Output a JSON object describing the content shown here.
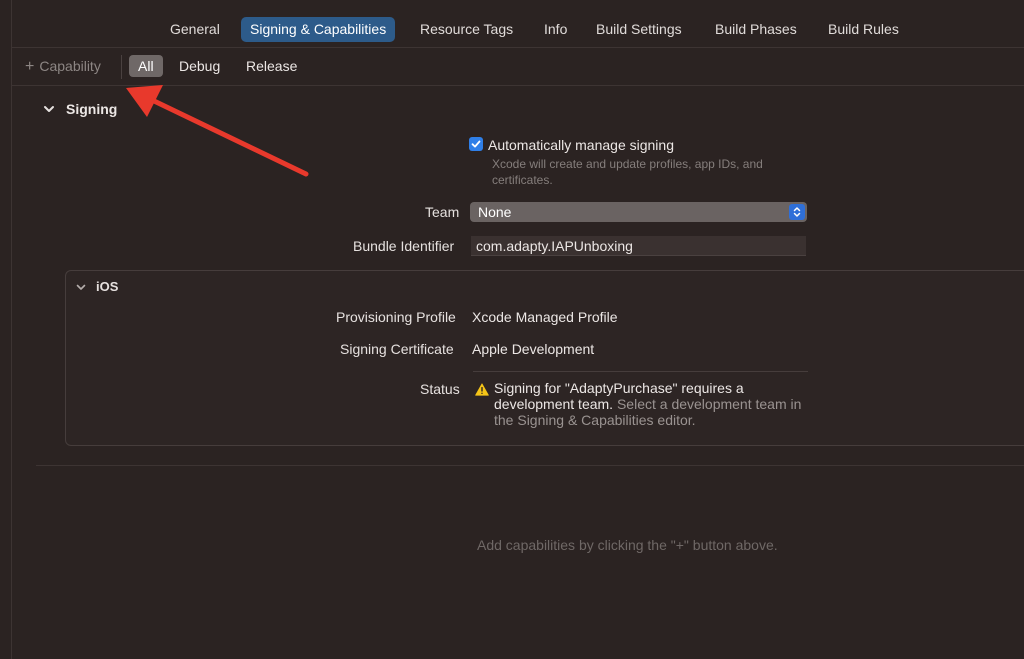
{
  "tabs": [
    {
      "label": "General"
    },
    {
      "label": "Signing & Capabilities"
    },
    {
      "label": "Resource Tags"
    },
    {
      "label": "Info"
    },
    {
      "label": "Build Settings"
    },
    {
      "label": "Build Phases"
    },
    {
      "label": "Build Rules"
    }
  ],
  "selected_tab": "Signing & Capabilities",
  "filterbar": {
    "add_capability": "Capability",
    "filters": [
      {
        "label": "All"
      },
      {
        "label": "Debug"
      },
      {
        "label": "Release"
      }
    ],
    "active_filter": "All"
  },
  "signing": {
    "title": "Signing",
    "auto_manage_label": "Automatically manage signing",
    "auto_manage_checked": true,
    "auto_manage_desc": "Xcode will create and update profiles, app IDs, and certificates.",
    "team_label": "Team",
    "team_value": "None",
    "bundle_label": "Bundle Identifier",
    "bundle_value": "com.adapty.IAPUnboxing"
  },
  "ios": {
    "title": "iOS",
    "provisioning_label": "Provisioning Profile",
    "provisioning_value": "Xcode Managed Profile",
    "certificate_label": "Signing Certificate",
    "certificate_value": "Apple Development",
    "status_label": "Status",
    "status_main": "Signing for \"AdaptyPurchase\" requires a development team.",
    "status_detail": "Select a development team in the Signing & Capabilities editor."
  },
  "hint": "Add capabilities by clicking the \"+\" button above.",
  "colors": {
    "background": "#2b2322",
    "accent": "#2d5b8a",
    "checkbox": "#2f7fe8",
    "warning": "#f5c518",
    "annotation_arrow": "#e8392c"
  }
}
